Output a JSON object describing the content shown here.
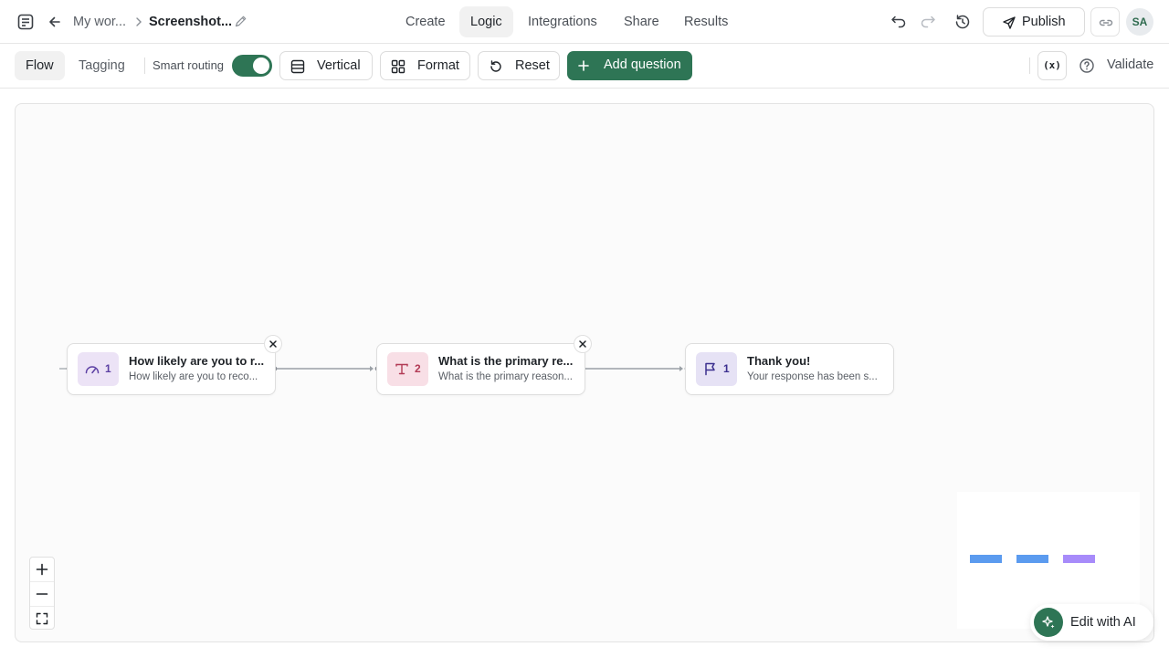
{
  "breadcrumb": {
    "workspace": "My wor...",
    "form_name": "Screenshot..."
  },
  "nav": {
    "create": "Create",
    "logic": "Logic",
    "integrations": "Integrations",
    "share": "Share",
    "results": "Results"
  },
  "header_actions": {
    "publish": "Publish",
    "avatar_initials": "SA"
  },
  "toolbar": {
    "flow_tab": "Flow",
    "tagging_tab": "Tagging",
    "smart_routing_label": "Smart routing",
    "smart_routing_on": true,
    "vertical_label": "Vertical",
    "format_label": "Format",
    "reset_label": "Reset",
    "add_question_label": "Add question",
    "variables_label": "(x)",
    "validate_label": "Validate"
  },
  "nodes": [
    {
      "number": "1",
      "title": "How likely are you to r...",
      "subtitle": "How likely are you to reco...",
      "icon": "gauge-icon",
      "badge_color": "#ece3f6",
      "icon_color": "#5b3fa3"
    },
    {
      "number": "2",
      "title": "What is the primary re...",
      "subtitle": "What is the primary reason...",
      "icon": "text-icon",
      "badge_color": "#f8dfe6",
      "icon_color": "#b23a55"
    },
    {
      "number": "1",
      "title": "Thank you!",
      "subtitle": "Your response has been s...",
      "icon": "flag-icon",
      "badge_color": "#e6e2f5",
      "icon_color": "#3b2f8f"
    }
  ],
  "minimap_colors": [
    "#5b9bef",
    "#5b9bef",
    "#a78bfa"
  ],
  "ai_button": {
    "label": "Edit with AI"
  },
  "colors": {
    "brand": "#2e7555"
  }
}
